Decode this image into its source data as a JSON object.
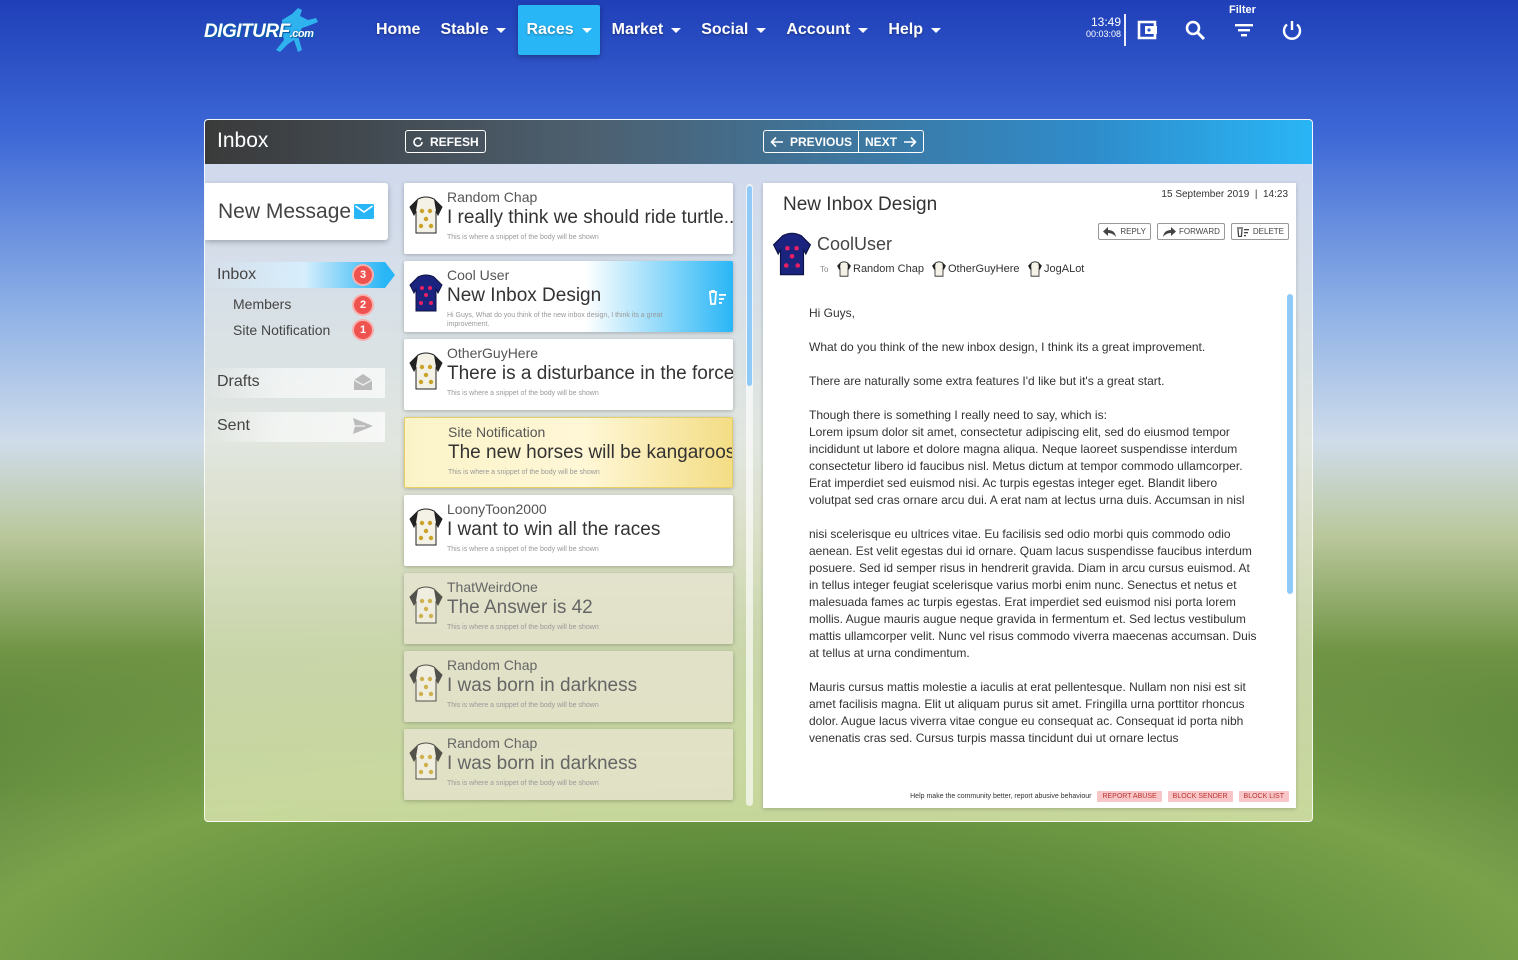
{
  "app": {
    "logo_text": "DIGITURF",
    "logo_suffix": ".com"
  },
  "nav": {
    "items": [
      {
        "label": "Home",
        "dropdown": false
      },
      {
        "label": "Stable",
        "dropdown": true
      },
      {
        "label": "Races",
        "dropdown": true,
        "active": true
      },
      {
        "label": "Market",
        "dropdown": true
      },
      {
        "label": "Social",
        "dropdown": true
      },
      {
        "label": "Account",
        "dropdown": true
      },
      {
        "label": "Help",
        "dropdown": true
      }
    ],
    "clock_time": "13:49",
    "clock_elapsed": "00:03:08",
    "filter_label": "Filter",
    "icons": [
      "wallet-icon",
      "search-icon",
      "filter-icon",
      "power-icon"
    ]
  },
  "header": {
    "title": "Inbox",
    "refresh_label": "REFESH",
    "previous_label": "PREVIOUS",
    "next_label": "NEXT"
  },
  "sidebar": {
    "new_message_label": "New Message",
    "inbox_label": "Inbox",
    "inbox_count": "3",
    "subfolders": [
      {
        "label": "Members",
        "count": "2"
      },
      {
        "label": "Site Notification",
        "count": "1"
      }
    ],
    "drafts_label": "Drafts",
    "sent_label": "Sent"
  },
  "messages": [
    {
      "from": "Random Chap",
      "subject": "I really think we should ride turtle..",
      "snippet": "This is where a snippet of the body will be shown",
      "state": "normal",
      "silk": "white-black"
    },
    {
      "from": "Cool User",
      "subject": "New Inbox Design",
      "snippet": "Hi Guys, What do you think of the new inbox design, I think its a great improvement.",
      "state": "selected",
      "silk": "navy-pink"
    },
    {
      "from": "OtherGuyHere",
      "subject": "There is a disturbance in the force",
      "snippet": "This is where a snippet of the body will be shown",
      "state": "normal",
      "silk": "white-black"
    },
    {
      "from": "Site Notification",
      "subject": "The new horses will be kangaroos",
      "snippet": "This is where a snippet of the body will be shown",
      "state": "notification",
      "silk": "none"
    },
    {
      "from": "LoonyToon2000",
      "subject": "I want to win all the races",
      "snippet": "This is where a snippet of the body will be shown",
      "state": "normal",
      "silk": "white-black"
    },
    {
      "from": "ThatWeirdOne",
      "subject": "The Answer is 42",
      "snippet": "This is where a snippet of the body will be shown",
      "state": "faded",
      "silk": "white-black"
    },
    {
      "from": "Random Chap",
      "subject": "I was born in darkness",
      "snippet": "This is where a snippet of the body will be shown",
      "state": "faded",
      "silk": "white-black"
    },
    {
      "from": "Random Chap",
      "subject": "I was born in darkness",
      "snippet": "This is where a snippet of the body will be shown",
      "state": "faded",
      "silk": "white-black"
    }
  ],
  "reader": {
    "subject": "New Inbox Design",
    "date": "15 September 2019  |  14:23",
    "actions": {
      "reply": "REPLY",
      "forward": "FORWARD",
      "delete": "DELETE"
    },
    "sender": "CoolUser",
    "to_label": "To",
    "recipients": [
      "Random Chap",
      "OtherGuyHere",
      "JogALot"
    ],
    "body": [
      "Hi Guys,",
      "What do you think of the new inbox design, I think its a great improvement.",
      "There are naturally some extra features I'd like but it's a great start.",
      "Though there is something I really need to say, which is:\nLorem ipsum dolor sit amet, consectetur adipiscing elit, sed do eiusmod tempor incididunt ut labore et dolore magna aliqua. Neque laoreet suspendisse interdum consectetur libero id faucibus nisl. Metus dictum at tempor commodo ullamcorper. Erat imperdiet sed euismod nisi. Ac turpis egestas integer eget. Blandit libero volutpat sed cras ornare arcu dui. A erat nam at lectus urna duis. Accumsan in nisl",
      "nisi scelerisque eu ultrices vitae. Eu facilisis sed odio morbi quis commodo odio aenean. Est velit egestas dui id ornare. Quam lacus suspendisse faucibus interdum posuere. Sed id semper risus in hendrerit gravida. Diam in arcu cursus euismod. At in tellus integer feugiat scelerisque varius morbi enim nunc. Senectus et netus et malesuada fames ac turpis egestas. Erat imperdiet sed euismod nisi porta lorem mollis. Augue mauris augue neque gravida in fermentum et. Sed lectus vestibulum mattis ullamcorper velit. Nunc vel risus commodo viverra maecenas accumsan. Duis at tellus at urna condimentum.",
      "Mauris cursus mattis molestie a iaculis at erat pellentesque. Nullam non nisi est sit amet facilisis magna. Elit ut aliquam purus sit amet. Fringilla urna porttitor rhoncus dolor. Augue lacus viverra vitae congue eu consequat ac. Consequat id porta nibh venenatis cras sed. Cursus turpis massa tincidunt dui ut ornare lectus"
    ],
    "footer_text": "Help make the community better, report abusive behaviour",
    "footer_buttons": [
      "REPORT ABUSE",
      "BLOCK SENDER",
      "BLOCK LIST"
    ]
  },
  "colors": {
    "accent": "#29b6f6",
    "badge": "#ef5350",
    "silk_navy": "#1a237e",
    "silk_pink": "#e91e63",
    "silk_gold": "#c9a227"
  }
}
